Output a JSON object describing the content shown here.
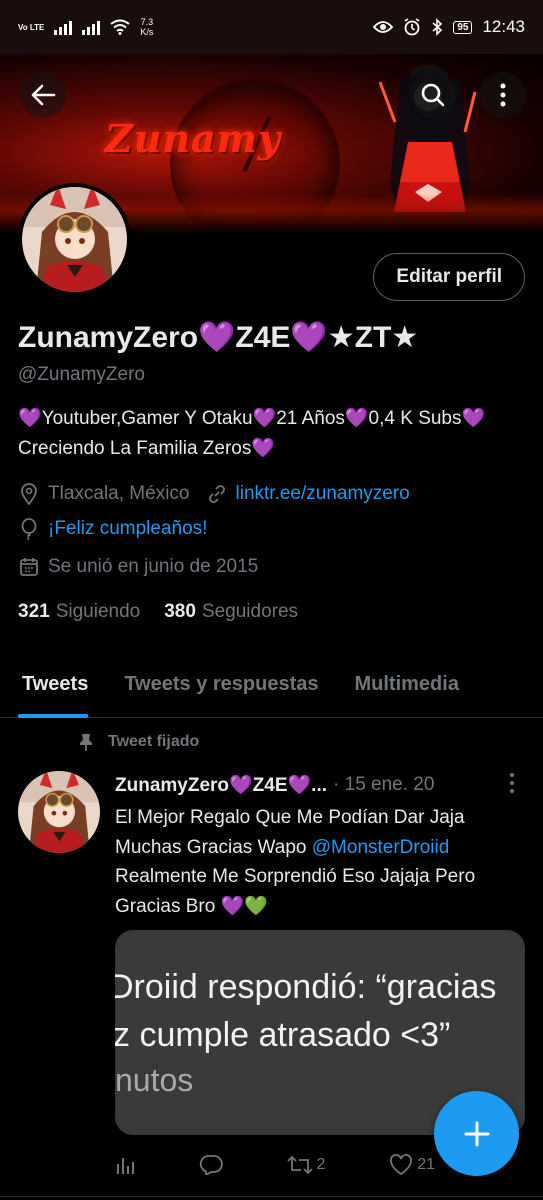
{
  "status_bar": {
    "network_label": "Vo LTE",
    "speed_value": "7.3",
    "speed_unit": "K/s",
    "battery": "95",
    "time": "12:43"
  },
  "banner": {
    "title": "Zunamy"
  },
  "profile": {
    "edit_button": "Editar perfil",
    "display_name": "ZunamyZero💜Z4E💜★ZT★",
    "handle": "@ZunamyZero",
    "bio": "💜Youtuber,Gamer Y Otaku💜21 Años💜0,4 K Subs💜Creciendo La Familia Zeros💜",
    "location": "Tlaxcala, México",
    "website": "linktr.ee/zunamyzero",
    "birthday": "¡Feliz cumpleaños!",
    "joined": "Se unió en junio de 2015",
    "following_count": "321",
    "following_label": "Siguiendo",
    "followers_count": "380",
    "followers_label": "Seguidores"
  },
  "tabs": [
    {
      "label": "Tweets"
    },
    {
      "label": "Tweets y respuestas"
    },
    {
      "label": "Multimedia"
    }
  ],
  "tweet": {
    "pinned_label": "Tweet fijado",
    "author": "ZunamyZero💜Z4E💜...",
    "date": "· 15 ene. 20",
    "text_part1": "El Mejor Regalo Que Me Podían Dar Jaja Muchas Gracias Wapo ",
    "mention": "@MonsterDroiid",
    "text_part2": " Realmente Me Sorprendió Eso Jajaja Pero Gracias Bro 💜💚",
    "media_line1": "Droiid respondió: “gracias",
    "media_line2": "z cumple atrasado <3”",
    "media_line3": "nutos",
    "retweets": "2",
    "likes": "21"
  },
  "colors": {
    "accent": "#1d9bf0",
    "background": "#000000",
    "secondary_text": "#71767b"
  }
}
